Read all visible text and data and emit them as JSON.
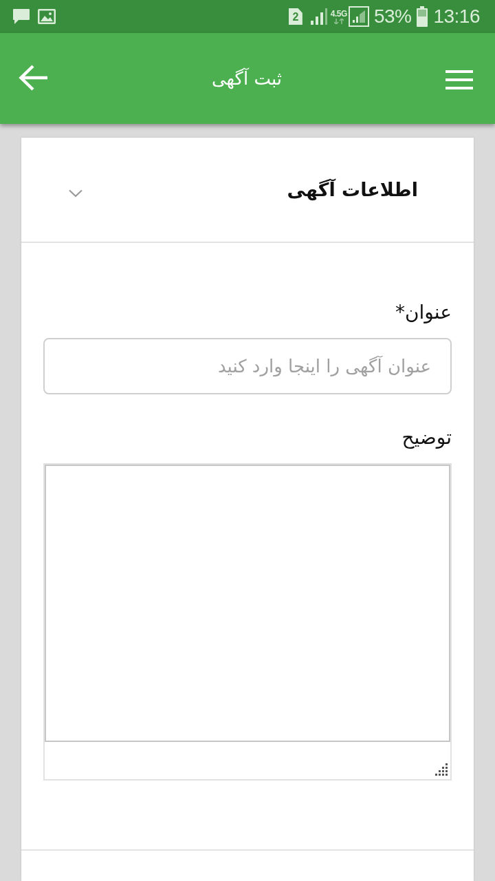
{
  "status_bar": {
    "sim_slot": "2",
    "network_type": "4.5G",
    "battery": "53%",
    "time": "13:16"
  },
  "app_bar": {
    "title": "ثبت آگهی"
  },
  "section": {
    "title": "اطلاعات آگهی",
    "fields": [
      {
        "kind": "text",
        "label": "عنوان*",
        "placeholder": "عنوان آگهی را اینجا وارد کنید"
      },
      {
        "kind": "textarea",
        "label": "توضیح"
      }
    ]
  }
}
